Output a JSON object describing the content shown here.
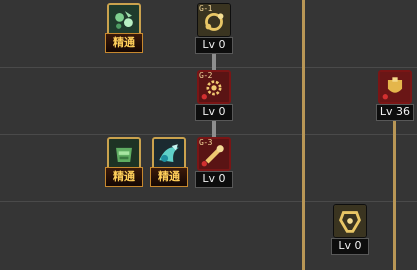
{
  "skills": [
    {
      "id": "mastery-1",
      "tag": "精通",
      "icon": "mastery-icon"
    },
    {
      "id": "g1",
      "badge": "G-1",
      "level": "Lv 0",
      "icon": "gear-rune-icon"
    },
    {
      "id": "g2",
      "badge": "G-2",
      "level": "Lv 0",
      "icon": "gear-rune-icon"
    },
    {
      "id": "red-r2",
      "level": "Lv 36",
      "icon": "shield-skill-icon"
    },
    {
      "id": "mastery-2",
      "tag": "精通",
      "icon": "mastery-icon"
    },
    {
      "id": "mastery-3",
      "tag": "精通",
      "icon": "mastery-icon"
    },
    {
      "id": "g3",
      "badge": "G-3",
      "level": "Lv 0",
      "icon": "gear-rune-icon"
    },
    {
      "id": "skill-r4",
      "level": "Lv 0",
      "icon": "armor-skill-icon"
    }
  ],
  "colors": {
    "background": "#353535",
    "gold": "#caa24e",
    "red": "#7a1515",
    "tier_line": "#b89656"
  }
}
